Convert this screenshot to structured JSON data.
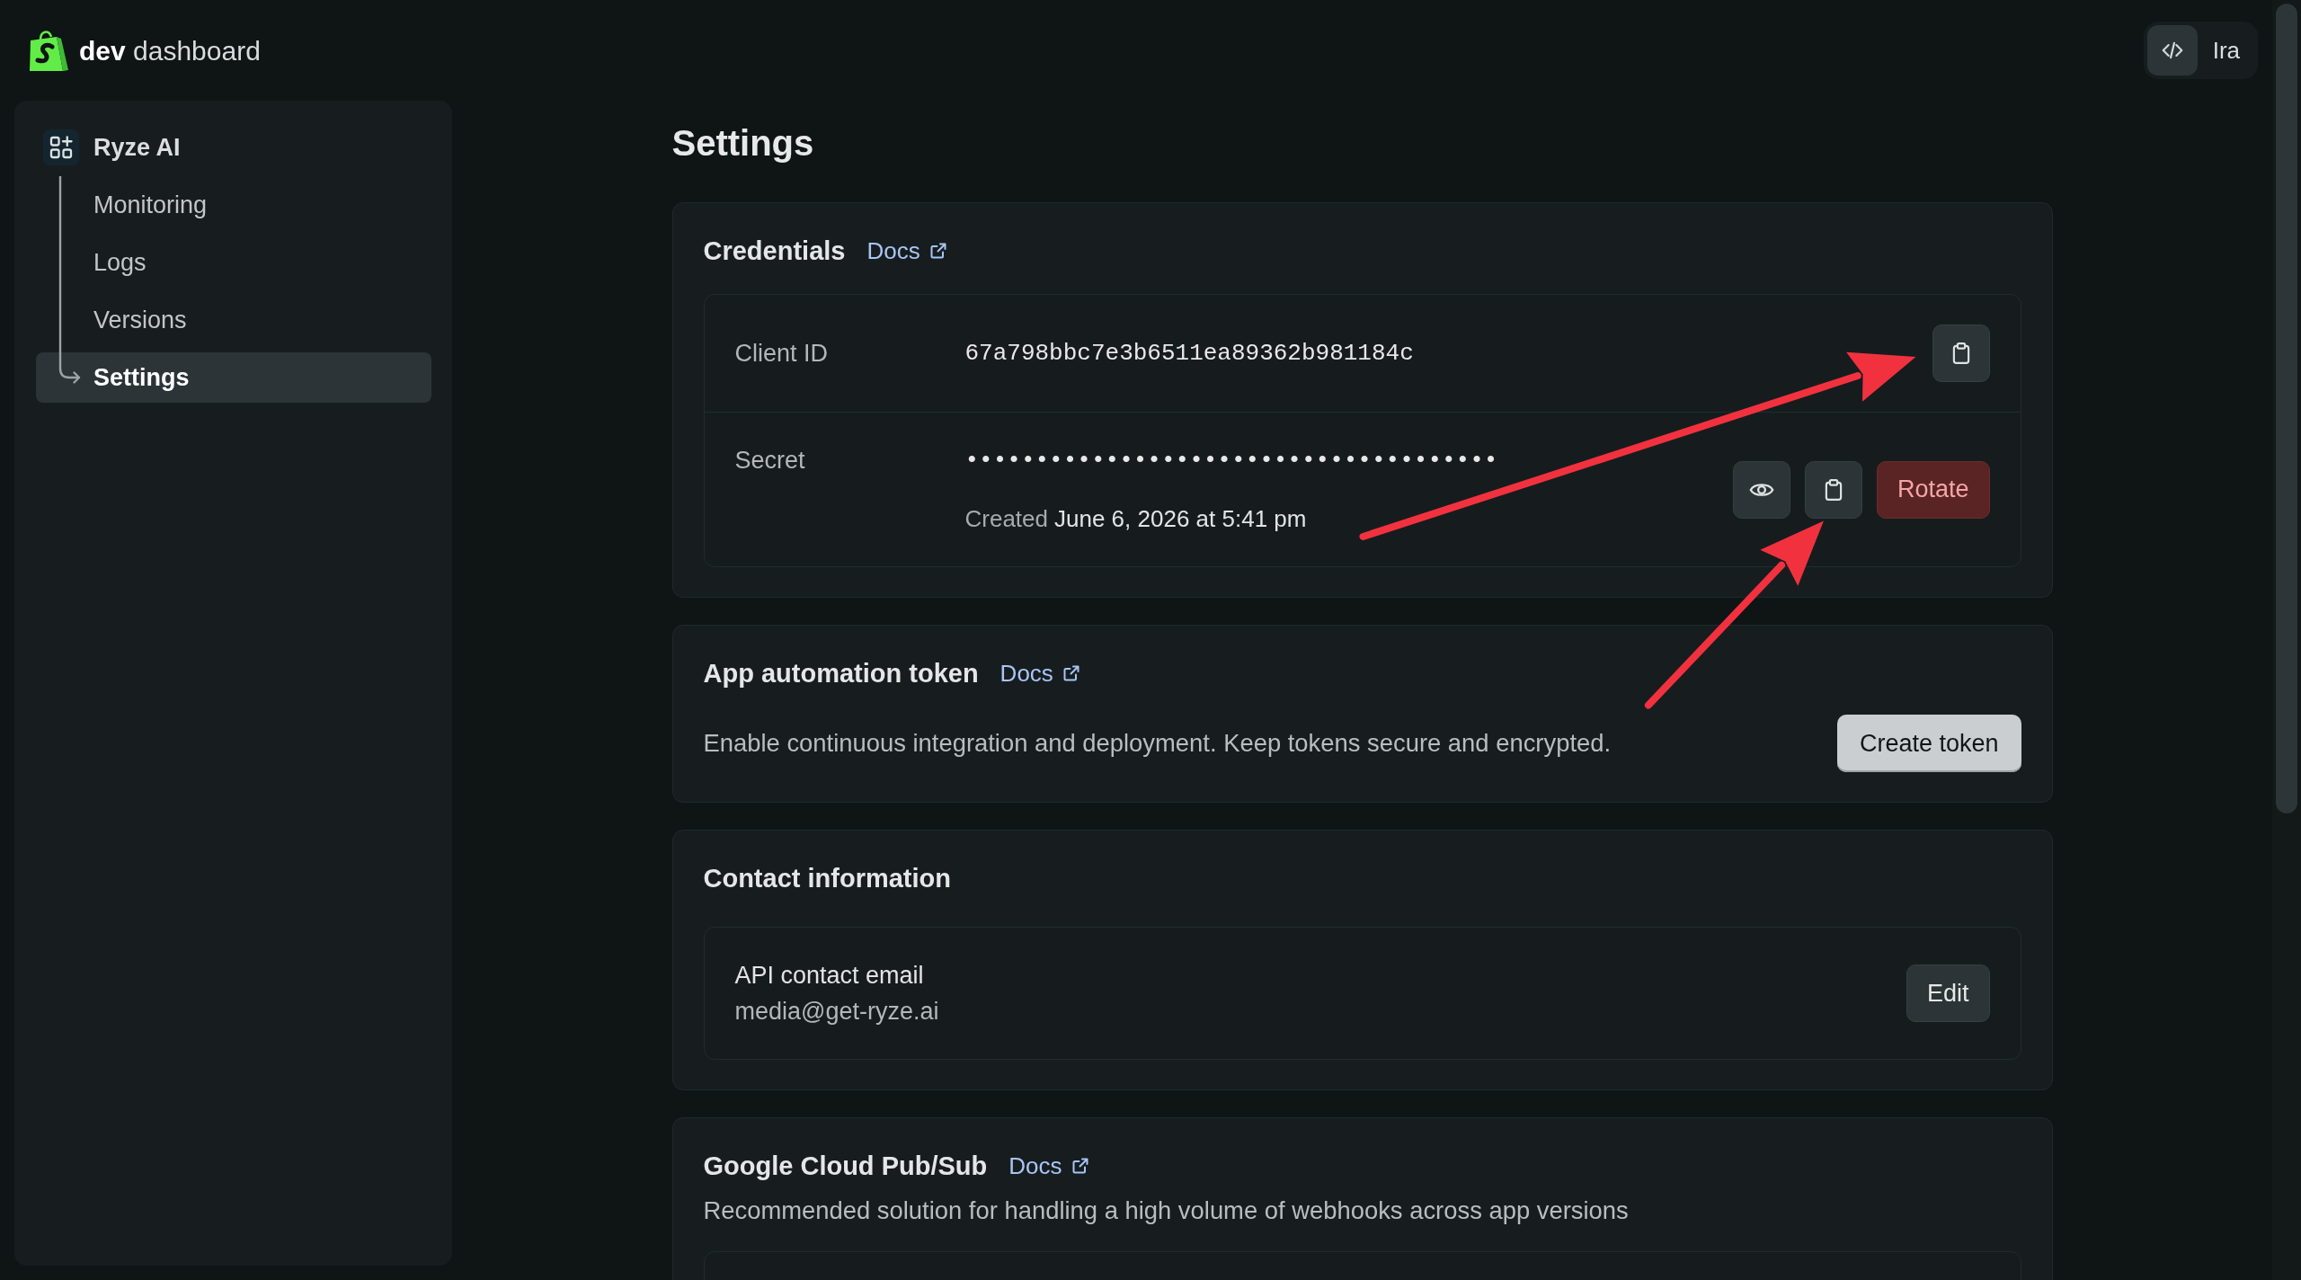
{
  "header": {
    "brand": "**dev** dashboard",
    "user": {
      "name": "Ira"
    }
  },
  "sidebar": {
    "app": {
      "name": "Ryze AI"
    },
    "items": [
      {
        "label": "Monitoring",
        "selected": false
      },
      {
        "label": "Logs",
        "selected": false
      },
      {
        "label": "Versions",
        "selected": false
      },
      {
        "label": "Settings",
        "selected": true
      }
    ]
  },
  "page": {
    "title": "Settings"
  },
  "sections": [
    {
      "kind": "credentials",
      "title": "Credentials",
      "docs": "Docs",
      "rows": [
        {
          "kind": "id",
          "label": "Client ID",
          "value": "67a798bbc7e3b6511ea89362b981184c",
          "actions": [
            {
              "kind": "copy",
              "arrow_annotation": true
            }
          ]
        },
        {
          "kind": "secret",
          "label": "Secret",
          "value": "••••••••••••••••••••••••••••••••••••••",
          "created_label": "Created",
          "created_at": "June 6, 2026 at 5:41 pm",
          "actions": [
            {
              "kind": "reveal",
              "arrow_annotation": false
            },
            {
              "kind": "copy",
              "arrow_annotation": true
            },
            {
              "kind": "danger",
              "label": "Rotate",
              "arrow_annotation": false
            }
          ]
        }
      ]
    },
    {
      "kind": "token",
      "title": "App automation token",
      "docs": "Docs",
      "description": "Enable continuous integration and deployment. Keep tokens secure and encrypted.",
      "action": {
        "kind": "primary",
        "label": "Create token"
      }
    },
    {
      "kind": "contact",
      "title": "Contact information",
      "rows": [
        {
          "kind": "contact",
          "label": "API contact email",
          "value": "media@get-ryze.ai",
          "actions": [
            {
              "kind": "secondary",
              "label": "Edit",
              "arrow_annotation": false
            }
          ]
        }
      ]
    },
    {
      "kind": "pubsub",
      "title": "Google Cloud Pub/Sub",
      "docs": "Docs",
      "description": "Recommended solution for handling a high volume of webhooks across app versions"
    }
  ]
}
